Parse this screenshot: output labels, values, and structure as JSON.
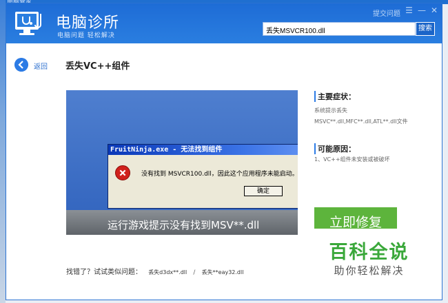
{
  "outer": {
    "title": "电脑管家"
  },
  "header": {
    "title": "电脑诊所",
    "subtitle": "电脑问题 轻松解决",
    "help_link": "提交问题",
    "search_value": "丢失MSVCR100.dll",
    "search_button": "搜索"
  },
  "nav": {
    "back_label": "返回",
    "page_title": "丢失VC++组件"
  },
  "screenshot": {
    "dialog_title": "FruitNinja.exe - 无法找到组件",
    "dialog_message": "没有找到 MSVCR100.dll，因此这个应用程序未能启动。",
    "dialog_ok": "确定",
    "caption": "运行游戏提示没有找到MSV**.dll"
  },
  "symptoms": {
    "heading": "主要症状：",
    "line1": "系统提示丢失",
    "line2": "MSVC**.dll,MFC**.dll,ATL**.dll文件"
  },
  "causes": {
    "heading": "可能原因：",
    "line1": "1、VC++组件未安装或被破坏"
  },
  "fix_button": "立即修复",
  "similar": {
    "prompt": "找错了？试试类似问题：",
    "link1": "丢失d3dx**.dll",
    "separator": "/",
    "link2": "丢失**eay32.dll"
  },
  "watermark": {
    "top": "百科全说",
    "bottom": "助你轻松解决"
  },
  "colors": {
    "header": "#2a7ee0",
    "fix_button": "#5db43c",
    "watermark": "#3aa83a"
  }
}
